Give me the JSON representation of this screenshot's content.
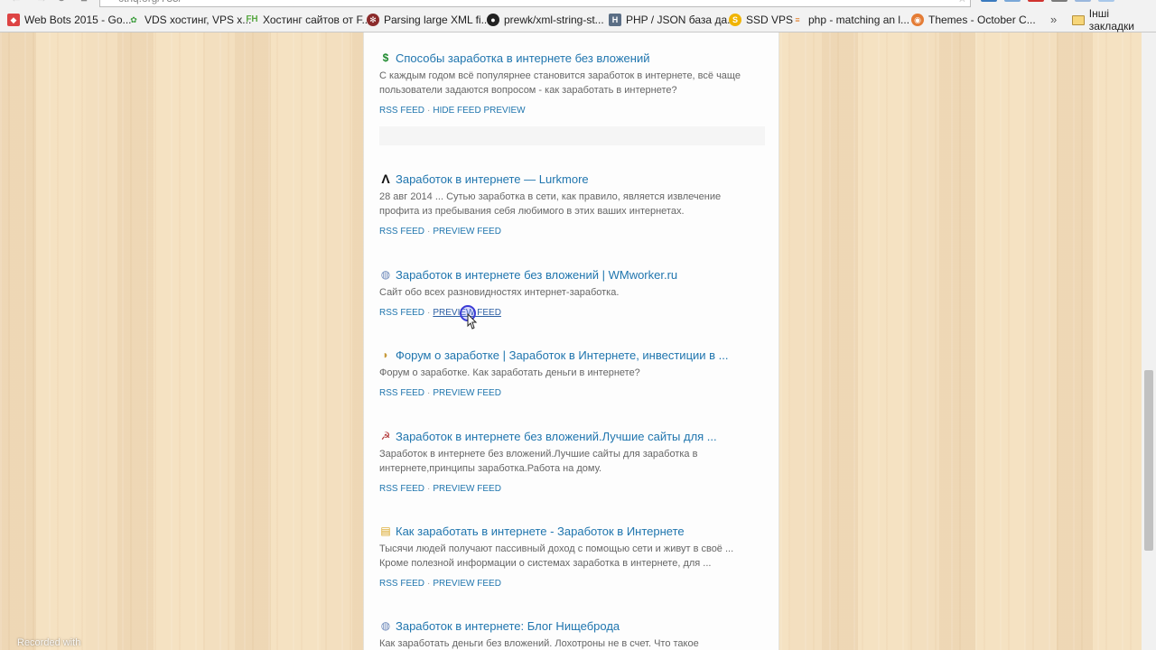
{
  "browser": {
    "url": "cthq.org/735/",
    "bookmarks": [
      {
        "label": "Web Bots 2015 - Go...",
        "icon": "google-icon"
      },
      {
        "label": "VDS хостинг, VPS х...",
        "icon": "tree-icon"
      },
      {
        "label": "Хостинг сайтов от F...",
        "icon": "fh-icon"
      },
      {
        "label": "Parsing large XML fi...",
        "icon": "gear-icon"
      },
      {
        "label": "prewk/xml-string-st...",
        "icon": "github-icon"
      },
      {
        "label": "PHP / JSON база да...",
        "icon": "habr-icon"
      },
      {
        "label": "SSD VPS",
        "icon": "ssd-icon"
      },
      {
        "label": "php - matching an l...",
        "icon": "stackoverflow-icon"
      },
      {
        "label": "Themes - October C...",
        "icon": "october-icon"
      }
    ],
    "more_label": "»",
    "other_bookmarks": "Інші закладки"
  },
  "results": [
    {
      "title": "Способы заработка в интернете без вложений",
      "icon": "dollar-icon",
      "desc1": "С каждым годом всё популярнее становится заработок в интернете, всё чаще",
      "desc2": "пользователи задаются вопросом - как заработать в интернете?",
      "rss": "RSS FEED",
      "preview": "HIDE FEED PREVIEW"
    },
    {
      "title": "Заработок в интернете — Lurkmore",
      "icon": "lambda-icon",
      "desc1": "28 авг 2014 ... Сутью заработка в сети, как правило, является извлечение",
      "desc2": "профита из пребывания себя любимого в этих ваших интернетах.",
      "rss": "RSS FEED",
      "preview": "PREVIEW FEED"
    },
    {
      "title": "Заработок в интернете без вложений | WMworker.ru",
      "icon": "globe-icon",
      "desc1": "Сайт обо всех разновидностях интернет-заработка.",
      "desc2": "",
      "rss": "RSS FEED",
      "preview": "PREVIEW FEED"
    },
    {
      "title": "Форум о заработке | Заработок в Интернете, инвестиции в ...",
      "icon": "coin-icon",
      "desc1": "Форум о заработке. Как заработать деньги в интернете?",
      "desc2": "",
      "rss": "RSS FEED",
      "preview": "PREVIEW FEED"
    },
    {
      "title": "Заработок в интернете без вложений.Лучшие сайты для ...",
      "icon": "hammer-sickle-icon",
      "desc1": "Заработок в интернете без вложений.Лучшие сайты для заработка в",
      "desc2": "интернете,принципы заработка.Работа на дому.",
      "rss": "RSS FEED",
      "preview": "PREVIEW FEED"
    },
    {
      "title": "Как заработать в интернете - Заработок в Интернете",
      "icon": "coins-icon",
      "desc1": "Тысячи людей получают пассивный доход с помощью сети и живут в своё ...",
      "desc2": "Кроме полезной информации о системах заработка в интернете, для ...",
      "rss": "RSS FEED",
      "preview": "PREVIEW FEED"
    },
    {
      "title": "Заработок в интернете: Блог Нищеброда",
      "icon": "globe-icon",
      "desc1": "Как заработать деньги без вложений. Лохотроны не в счет. Что такое",
      "desc2": "",
      "rss": "",
      "preview": ""
    }
  ],
  "link_separator": "·",
  "watermark": "Recorded with",
  "colors": {
    "link": "#1f75ae",
    "desc": "#666666",
    "background": "#f3dfbf"
  }
}
